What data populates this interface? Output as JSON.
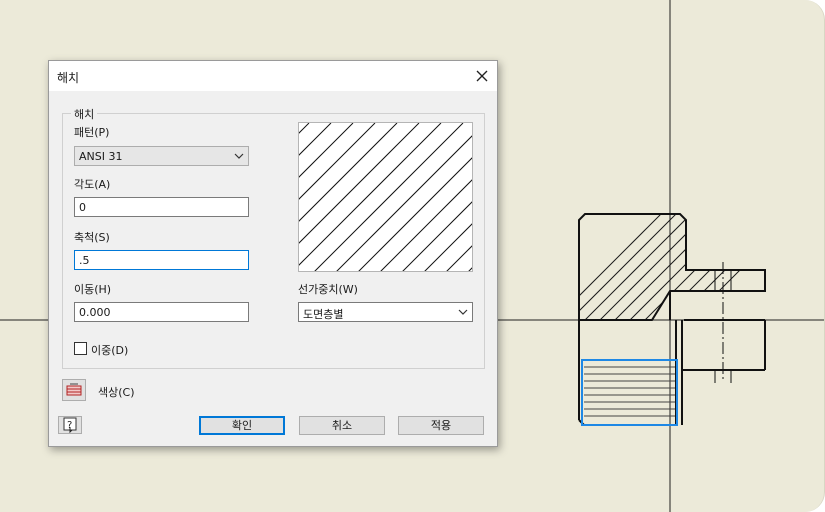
{
  "dialog": {
    "title": "해치",
    "group_label": "해치",
    "pattern": {
      "label": "패턴(P)",
      "value": "ANSI 31"
    },
    "angle": {
      "label": "각도(A)",
      "value": "0"
    },
    "scale": {
      "label": "축척(S)",
      "value": ".5"
    },
    "offset": {
      "label": "이동(H)",
      "value": "0.000"
    },
    "line_weight": {
      "label": "선가중치(W)",
      "value": "도면층별"
    },
    "double": {
      "label": "이중(D)",
      "checked": false
    },
    "color_label": "색상(C)",
    "buttons": {
      "ok": "확인",
      "cancel": "취소",
      "apply": "적용"
    }
  },
  "colors": {
    "canvas": "#ecead9",
    "selection": "#1e88e5",
    "accent": "#0078d7"
  }
}
